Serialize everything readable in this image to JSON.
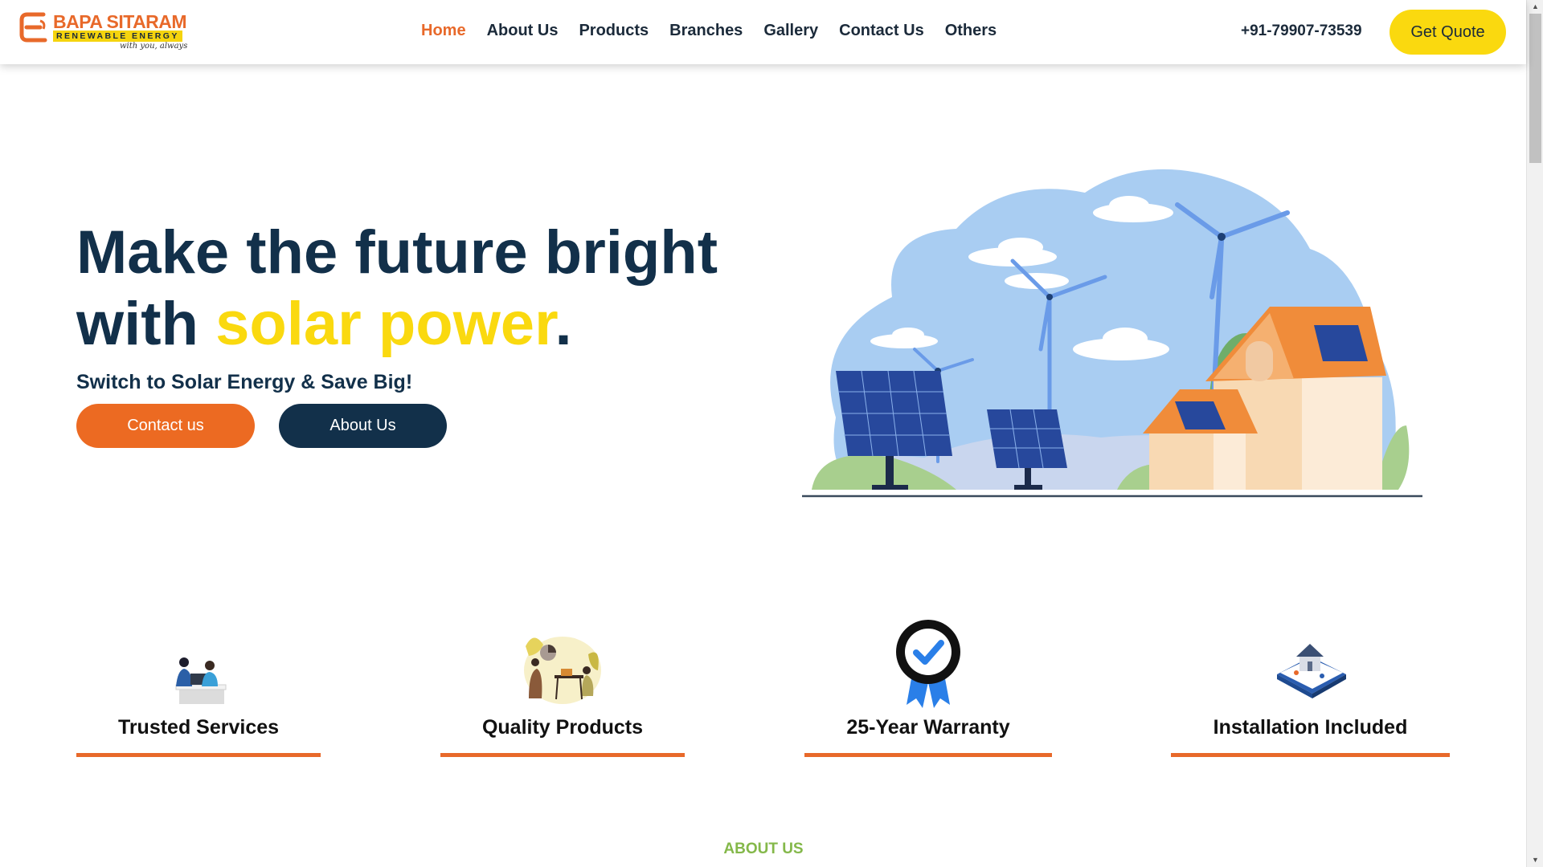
{
  "brand": {
    "name": "BAPA SITARAM",
    "tagline": "RENEWABLE ENERGY",
    "slogan": "with you, always",
    "accent_color": "#e8692a",
    "yellow_color": "#fad90f",
    "navy_color": "#12304a"
  },
  "nav": {
    "items": [
      {
        "label": "Home",
        "active": true
      },
      {
        "label": "About Us",
        "active": false
      },
      {
        "label": "Products",
        "active": false
      },
      {
        "label": "Branches",
        "active": false
      },
      {
        "label": "Gallery",
        "active": false
      },
      {
        "label": "Contact Us",
        "active": false
      },
      {
        "label": "Others",
        "active": false
      }
    ],
    "phone": "+91-79907-73539",
    "cta": "Get Quote"
  },
  "hero": {
    "title_line1": "Make the future bright",
    "title_line2_prefix": "with ",
    "title_line2_accent": "solar power",
    "title_line2_suffix": ".",
    "subtitle": "Switch to Solar Energy & Save Big!",
    "primary_button": "Contact us",
    "secondary_button": "About Us"
  },
  "features": [
    {
      "label": "Trusted Services",
      "icon": "people-laptop-icon"
    },
    {
      "label": "Quality Products",
      "icon": "team-presentation-icon"
    },
    {
      "label": "25-Year Warranty",
      "icon": "warranty-badge-icon"
    },
    {
      "label": "Installation Included",
      "icon": "house-installation-icon"
    }
  ],
  "about_section": {
    "heading": "ABOUT US"
  }
}
